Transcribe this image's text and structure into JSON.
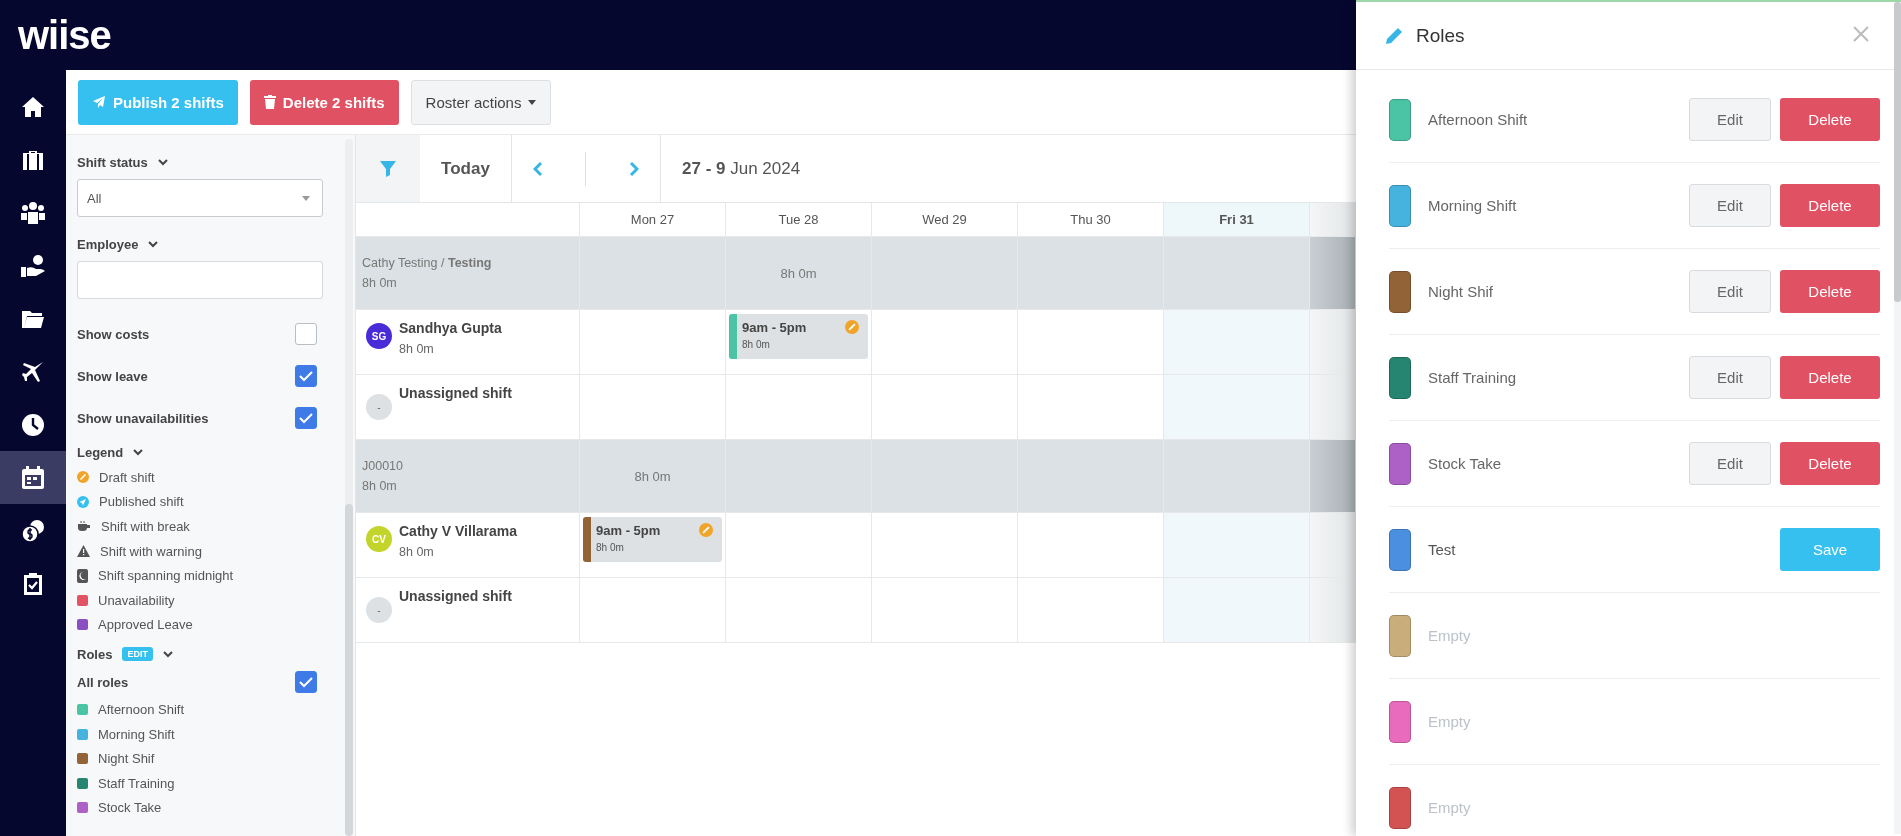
{
  "logo": "wiise",
  "nav_rail": [
    {
      "selected": false
    },
    {
      "selected": false
    },
    {
      "selected": false
    },
    {
      "selected": false
    },
    {
      "selected": false
    },
    {
      "selected": false
    },
    {
      "selected": false
    },
    {
      "selected": true
    },
    {
      "selected": false
    },
    {
      "selected": false
    }
  ],
  "toolbar": [
    {
      "kind": "publish",
      "label": "Publish 2 shifts"
    },
    {
      "kind": "delete",
      "label": "Delete 2 shifts"
    },
    {
      "kind": "menu",
      "label": "Roster actions"
    }
  ],
  "filters": {
    "shift_status": {
      "label": "Shift status",
      "value": "All"
    },
    "employee": {
      "label": "Employee"
    },
    "toggles": [
      {
        "label": "Show costs",
        "checked": false
      },
      {
        "label": "Show leave",
        "checked": true
      },
      {
        "label": "Show unavailabilities",
        "checked": true
      }
    ],
    "legend": {
      "label": "Legend",
      "items": [
        {
          "kind": "draft",
          "label": "Draft shift"
        },
        {
          "kind": "published",
          "label": "Published shift"
        },
        {
          "kind": "break",
          "label": "Shift with break"
        },
        {
          "kind": "warning",
          "label": "Shift with warning"
        },
        {
          "kind": "midnight",
          "label": "Shift spanning midnight"
        },
        {
          "kind": "swatch",
          "label": "Unavailability",
          "color": "#e25365"
        },
        {
          "kind": "swatch",
          "label": "Approved Leave",
          "color": "#8b4fc1"
        }
      ]
    },
    "roles": {
      "label": "Roles",
      "badge": "EDIT",
      "all": {
        "label": "All roles",
        "checked": true
      },
      "items": [
        {
          "label": "Afternoon Shift",
          "color": "#4bc4a5"
        },
        {
          "label": "Morning Shift",
          "color": "#45b3de"
        },
        {
          "label": "Night Shif",
          "color": "#936338"
        },
        {
          "label": "Staff Training",
          "color": "#268570"
        },
        {
          "label": "Stock Take",
          "color": "#ad60c6"
        }
      ]
    }
  },
  "calendar": {
    "today": "Today",
    "range": "**27 - 9** Jun 2024",
    "days": [
      {
        "label": "Mon 27",
        "highlighted": false
      },
      {
        "label": "Tue 28",
        "highlighted": false
      },
      {
        "label": "Wed 29",
        "highlighted": false
      },
      {
        "label": "Thu 30",
        "highlighted": false
      },
      {
        "label": "Fri 31",
        "highlighted": true
      }
    ],
    "groups": [
      {
        "title": "Cathy Testing / **Testing**",
        "hours": "8h 0m",
        "day_totals": [
          {
            "kind": "empty"
          },
          {
            "kind": "total",
            "text": "8h 0m"
          },
          {
            "kind": "empty"
          },
          {
            "kind": "empty"
          },
          {
            "kind": "empty"
          }
        ],
        "rows": [
          {
            "kind": "employee",
            "initials": "SG",
            "color": "#4a2bd8",
            "name": "Sandhya Gupta",
            "hours": "8h 0m",
            "days": [
              {
                "kind": "empty"
              },
              {
                "kind": "draft_shift",
                "time": "9am - 5pm",
                "hours": "8h 0m",
                "color": "#4bc4a5"
              },
              {
                "kind": "empty"
              },
              {
                "kind": "empty"
              },
              {
                "kind": "empty"
              }
            ]
          },
          {
            "kind": "unassigned",
            "initials": "-",
            "name": "Unassigned shift"
          }
        ]
      },
      {
        "title": "J00010",
        "hours": "8h 0m",
        "day_totals": [
          {
            "kind": "total",
            "text": "8h 0m"
          },
          {
            "kind": "empty"
          },
          {
            "kind": "empty"
          },
          {
            "kind": "empty"
          },
          {
            "kind": "empty"
          }
        ],
        "rows": [
          {
            "kind": "employee",
            "initials": "CV",
            "color": "#c3d42b",
            "name": "Cathy V Villarama",
            "hours": "8h 0m",
            "days": [
              {
                "kind": "draft_shift",
                "time": "9am - 5pm",
                "hours": "8h 0m",
                "color": "#936338"
              },
              {
                "kind": "empty"
              },
              {
                "kind": "empty"
              },
              {
                "kind": "empty"
              },
              {
                "kind": "empty"
              }
            ]
          },
          {
            "kind": "unassigned",
            "initials": "-",
            "name": "Unassigned shift"
          }
        ]
      }
    ]
  },
  "panel": {
    "title": "Roles",
    "roles": [
      {
        "kind": "saved",
        "name": "Afternoon Shift",
        "color": "#4bc4a5",
        "edit": "Edit",
        "delete": "Delete"
      },
      {
        "kind": "saved",
        "name": "Morning Shift",
        "color": "#45b3de",
        "edit": "Edit",
        "delete": "Delete"
      },
      {
        "kind": "saved",
        "name": "Night Shif",
        "color": "#936338",
        "edit": "Edit",
        "delete": "Delete"
      },
      {
        "kind": "saved",
        "name": "Staff Training",
        "color": "#268570",
        "edit": "Edit",
        "delete": "Delete"
      },
      {
        "kind": "saved",
        "name": "Stock Take",
        "color": "#ad60c6",
        "edit": "Edit",
        "delete": "Delete"
      },
      {
        "kind": "editing",
        "value": "Test",
        "color": "#4a8fe0",
        "save": "Save"
      },
      {
        "kind": "empty",
        "placeholder": "Empty",
        "color": "#c9ae7c"
      },
      {
        "kind": "empty",
        "placeholder": "Empty",
        "color": "#e86bbd"
      },
      {
        "kind": "empty",
        "placeholder": "Empty",
        "color": "#d35352"
      }
    ]
  }
}
